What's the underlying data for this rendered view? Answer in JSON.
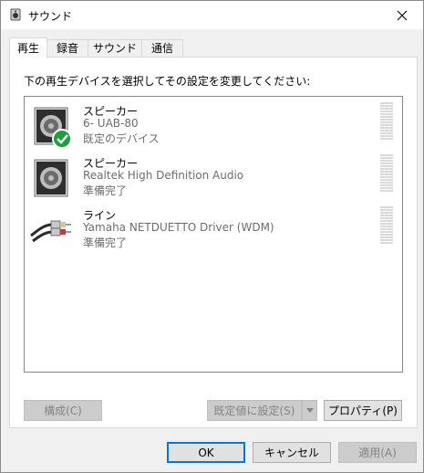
{
  "window": {
    "title": "サウンド"
  },
  "tabs": [
    {
      "label": "再生"
    },
    {
      "label": "録音"
    },
    {
      "label": "サウンド"
    },
    {
      "label": "通信"
    }
  ],
  "playback": {
    "instruction": "下の再生デバイスを選択してその設定を変更してください:",
    "devices": [
      {
        "name": "スピーカー",
        "description": "6- UAB-80",
        "status": "既定のデバイス",
        "icon": "speaker-icon",
        "default": true
      },
      {
        "name": "スピーカー",
        "description": "Realtek High Definition Audio",
        "status": "準備完了",
        "icon": "speaker-icon",
        "default": false
      },
      {
        "name": "ライン",
        "description": "Yamaha NETDUETTO Driver (WDM)",
        "status": "準備完了",
        "icon": "audio-cable-icon",
        "default": false
      }
    ]
  },
  "buttons": {
    "configure": "構成(C)",
    "set_default": "既定値に設定(S)",
    "properties": "プロパティ(P)",
    "ok": "OK",
    "cancel": "キャンセル",
    "apply": "適用(A)"
  },
  "colors": {
    "accent": "#0078d7",
    "check": "#1e9e3e"
  }
}
